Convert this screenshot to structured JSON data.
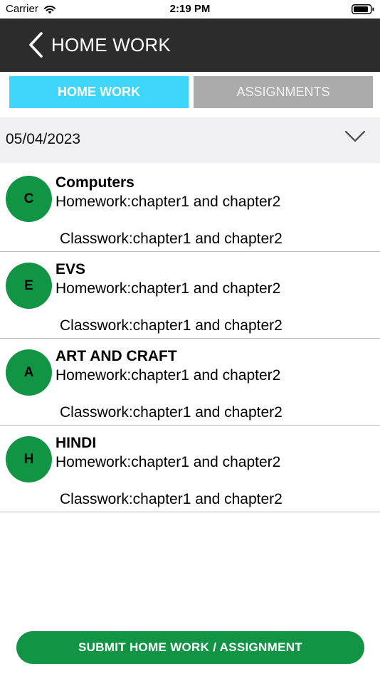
{
  "status_bar": {
    "carrier": "Carrier",
    "time": "2:19 PM"
  },
  "header": {
    "title": "HOME WORK"
  },
  "tabs": [
    {
      "label": "HOME WORK",
      "active": true
    },
    {
      "label": "ASSIGNMENTS",
      "active": false
    }
  ],
  "date_selector": {
    "value": "05/04/2023"
  },
  "items": [
    {
      "initial": "C",
      "subject": "Computers",
      "homework": "Homework:chapter1 and chapter2",
      "classwork": "Classwork:chapter1 and chapter2"
    },
    {
      "initial": "E",
      "subject": "EVS",
      "homework": "Homework:chapter1 and chapter2",
      "classwork": "Classwork:chapter1 and chapter2"
    },
    {
      "initial": "A",
      "subject": "ART AND CRAFT",
      "homework": "Homework:chapter1 and chapter2",
      "classwork": "Classwork:chapter1 and chapter2"
    },
    {
      "initial": "H",
      "subject": "HINDI",
      "homework": "Homework:chapter1 and chapter2",
      "classwork": "Classwork:chapter1 and chapter2"
    }
  ],
  "submit_button": {
    "label": "SUBMIT HOME WORK / ASSIGNMENT"
  },
  "colors": {
    "nav_bar": "#2c2c2c",
    "tab_active": "#3fd6fb",
    "tab_inactive": "#ababab",
    "avatar": "#119443",
    "submit_button": "#119443",
    "date_row": "#efeff4"
  },
  "icons": {
    "back": "back-chevron-icon",
    "dropdown": "chevron-down-icon",
    "wifi": "wifi-icon",
    "battery": "battery-icon"
  }
}
